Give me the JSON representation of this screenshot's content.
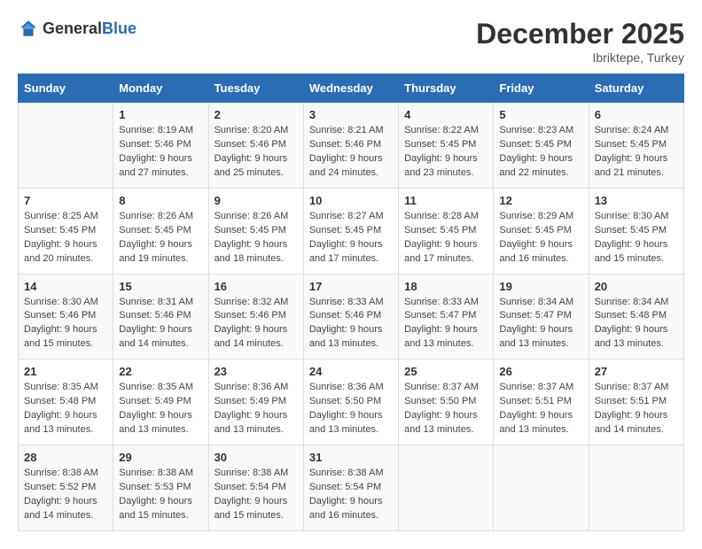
{
  "logo": {
    "general": "General",
    "blue": "Blue"
  },
  "title": "December 2025",
  "location": "Ibriktepe, Turkey",
  "days_of_week": [
    "Sunday",
    "Monday",
    "Tuesday",
    "Wednesday",
    "Thursday",
    "Friday",
    "Saturday"
  ],
  "weeks": [
    [
      {
        "day": "",
        "info": ""
      },
      {
        "day": "1",
        "info": "Sunrise: 8:19 AM\nSunset: 5:46 PM\nDaylight: 9 hours\nand 27 minutes."
      },
      {
        "day": "2",
        "info": "Sunrise: 8:20 AM\nSunset: 5:46 PM\nDaylight: 9 hours\nand 25 minutes."
      },
      {
        "day": "3",
        "info": "Sunrise: 8:21 AM\nSunset: 5:46 PM\nDaylight: 9 hours\nand 24 minutes."
      },
      {
        "day": "4",
        "info": "Sunrise: 8:22 AM\nSunset: 5:45 PM\nDaylight: 9 hours\nand 23 minutes."
      },
      {
        "day": "5",
        "info": "Sunrise: 8:23 AM\nSunset: 5:45 PM\nDaylight: 9 hours\nand 22 minutes."
      },
      {
        "day": "6",
        "info": "Sunrise: 8:24 AM\nSunset: 5:45 PM\nDaylight: 9 hours\nand 21 minutes."
      }
    ],
    [
      {
        "day": "7",
        "info": "Sunrise: 8:25 AM\nSunset: 5:45 PM\nDaylight: 9 hours\nand 20 minutes."
      },
      {
        "day": "8",
        "info": "Sunrise: 8:26 AM\nSunset: 5:45 PM\nDaylight: 9 hours\nand 19 minutes."
      },
      {
        "day": "9",
        "info": "Sunrise: 8:26 AM\nSunset: 5:45 PM\nDaylight: 9 hours\nand 18 minutes."
      },
      {
        "day": "10",
        "info": "Sunrise: 8:27 AM\nSunset: 5:45 PM\nDaylight: 9 hours\nand 17 minutes."
      },
      {
        "day": "11",
        "info": "Sunrise: 8:28 AM\nSunset: 5:45 PM\nDaylight: 9 hours\nand 17 minutes."
      },
      {
        "day": "12",
        "info": "Sunrise: 8:29 AM\nSunset: 5:45 PM\nDaylight: 9 hours\nand 16 minutes."
      },
      {
        "day": "13",
        "info": "Sunrise: 8:30 AM\nSunset: 5:45 PM\nDaylight: 9 hours\nand 15 minutes."
      }
    ],
    [
      {
        "day": "14",
        "info": "Sunrise: 8:30 AM\nSunset: 5:46 PM\nDaylight: 9 hours\nand 15 minutes."
      },
      {
        "day": "15",
        "info": "Sunrise: 8:31 AM\nSunset: 5:46 PM\nDaylight: 9 hours\nand 14 minutes."
      },
      {
        "day": "16",
        "info": "Sunrise: 8:32 AM\nSunset: 5:46 PM\nDaylight: 9 hours\nand 14 minutes."
      },
      {
        "day": "17",
        "info": "Sunrise: 8:33 AM\nSunset: 5:46 PM\nDaylight: 9 hours\nand 13 minutes."
      },
      {
        "day": "18",
        "info": "Sunrise: 8:33 AM\nSunset: 5:47 PM\nDaylight: 9 hours\nand 13 minutes."
      },
      {
        "day": "19",
        "info": "Sunrise: 8:34 AM\nSunset: 5:47 PM\nDaylight: 9 hours\nand 13 minutes."
      },
      {
        "day": "20",
        "info": "Sunrise: 8:34 AM\nSunset: 5:48 PM\nDaylight: 9 hours\nand 13 minutes."
      }
    ],
    [
      {
        "day": "21",
        "info": "Sunrise: 8:35 AM\nSunset: 5:48 PM\nDaylight: 9 hours\nand 13 minutes."
      },
      {
        "day": "22",
        "info": "Sunrise: 8:35 AM\nSunset: 5:49 PM\nDaylight: 9 hours\nand 13 minutes."
      },
      {
        "day": "23",
        "info": "Sunrise: 8:36 AM\nSunset: 5:49 PM\nDaylight: 9 hours\nand 13 minutes."
      },
      {
        "day": "24",
        "info": "Sunrise: 8:36 AM\nSunset: 5:50 PM\nDaylight: 9 hours\nand 13 minutes."
      },
      {
        "day": "25",
        "info": "Sunrise: 8:37 AM\nSunset: 5:50 PM\nDaylight: 9 hours\nand 13 minutes."
      },
      {
        "day": "26",
        "info": "Sunrise: 8:37 AM\nSunset: 5:51 PM\nDaylight: 9 hours\nand 13 minutes."
      },
      {
        "day": "27",
        "info": "Sunrise: 8:37 AM\nSunset: 5:51 PM\nDaylight: 9 hours\nand 14 minutes."
      }
    ],
    [
      {
        "day": "28",
        "info": "Sunrise: 8:38 AM\nSunset: 5:52 PM\nDaylight: 9 hours\nand 14 minutes."
      },
      {
        "day": "29",
        "info": "Sunrise: 8:38 AM\nSunset: 5:53 PM\nDaylight: 9 hours\nand 15 minutes."
      },
      {
        "day": "30",
        "info": "Sunrise: 8:38 AM\nSunset: 5:54 PM\nDaylight: 9 hours\nand 15 minutes."
      },
      {
        "day": "31",
        "info": "Sunrise: 8:38 AM\nSunset: 5:54 PM\nDaylight: 9 hours\nand 16 minutes."
      },
      {
        "day": "",
        "info": ""
      },
      {
        "day": "",
        "info": ""
      },
      {
        "day": "",
        "info": ""
      }
    ]
  ]
}
